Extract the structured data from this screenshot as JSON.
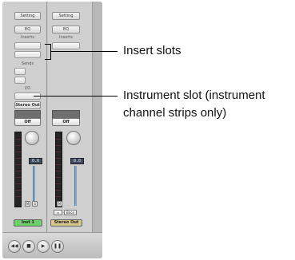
{
  "strips": [
    {
      "setting_label": "Setting",
      "eq_label": "EQ",
      "inserts_label": "Inserts",
      "sends_label": "Sends",
      "io_label": "I/O",
      "output_label": "Stereo Out",
      "automation_label": "Off",
      "volume_value": "0.0",
      "mute_label": "M",
      "solo_label": "S",
      "name": "Inst 1",
      "name_color": "#6fcf6a"
    },
    {
      "setting_label": "Setting",
      "eq_label": "EQ",
      "inserts_label": "Inserts",
      "automation_label": "Off",
      "volume_value": "0.0",
      "link_label": "∞",
      "mute_label": "M",
      "bounce_label": "Bnce",
      "name": "Stereo Out",
      "name_color": "#d8c58c"
    }
  ],
  "transport": {
    "icons": [
      "rewind-icon",
      "stop-icon",
      "play-icon",
      "pause-icon"
    ],
    "glyphs": [
      "◀◀",
      "■",
      "▶",
      "❚❚"
    ]
  },
  "callouts": {
    "insert_slots": "Insert slots",
    "instrument_slot_line1": "Instrument slot (instrument",
    "instrument_slot_line2": "channel strips only)"
  }
}
